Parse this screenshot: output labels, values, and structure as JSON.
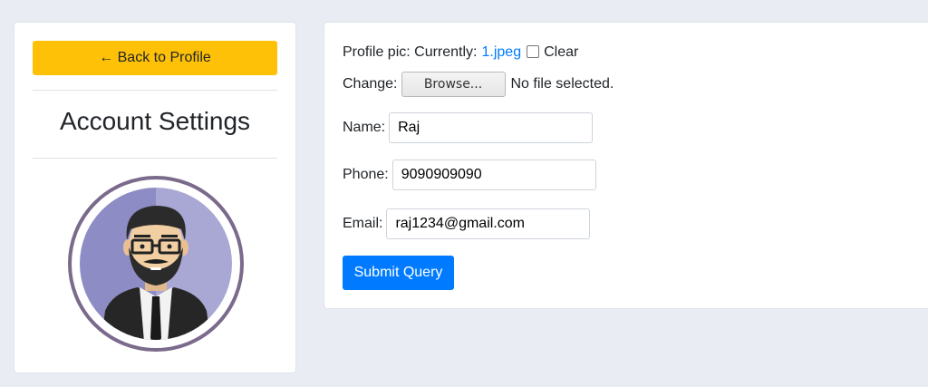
{
  "sidebar": {
    "back_label": "← Back to Profile",
    "title": "Account Settings"
  },
  "form": {
    "profile_pic_label": "Profile pic: Currently:",
    "current_file": "1.jpeg",
    "clear_label": "Clear",
    "change_label": "Change:",
    "browse_label": "Browse...",
    "no_file_text": "No file selected.",
    "name_label": "Name:",
    "name_value": "Raj",
    "phone_label": "Phone:",
    "phone_value": "9090909090",
    "email_label": "Email:",
    "email_value": "raj1234@gmail.com",
    "submit_label": "Submit Query"
  },
  "colors": {
    "back_button": "#ffc107",
    "submit_button": "#007bff",
    "link": "#007bff",
    "page_background": "#e9ecf3"
  },
  "icons": {
    "avatar": "user-avatar-bearded-man-glasses"
  }
}
